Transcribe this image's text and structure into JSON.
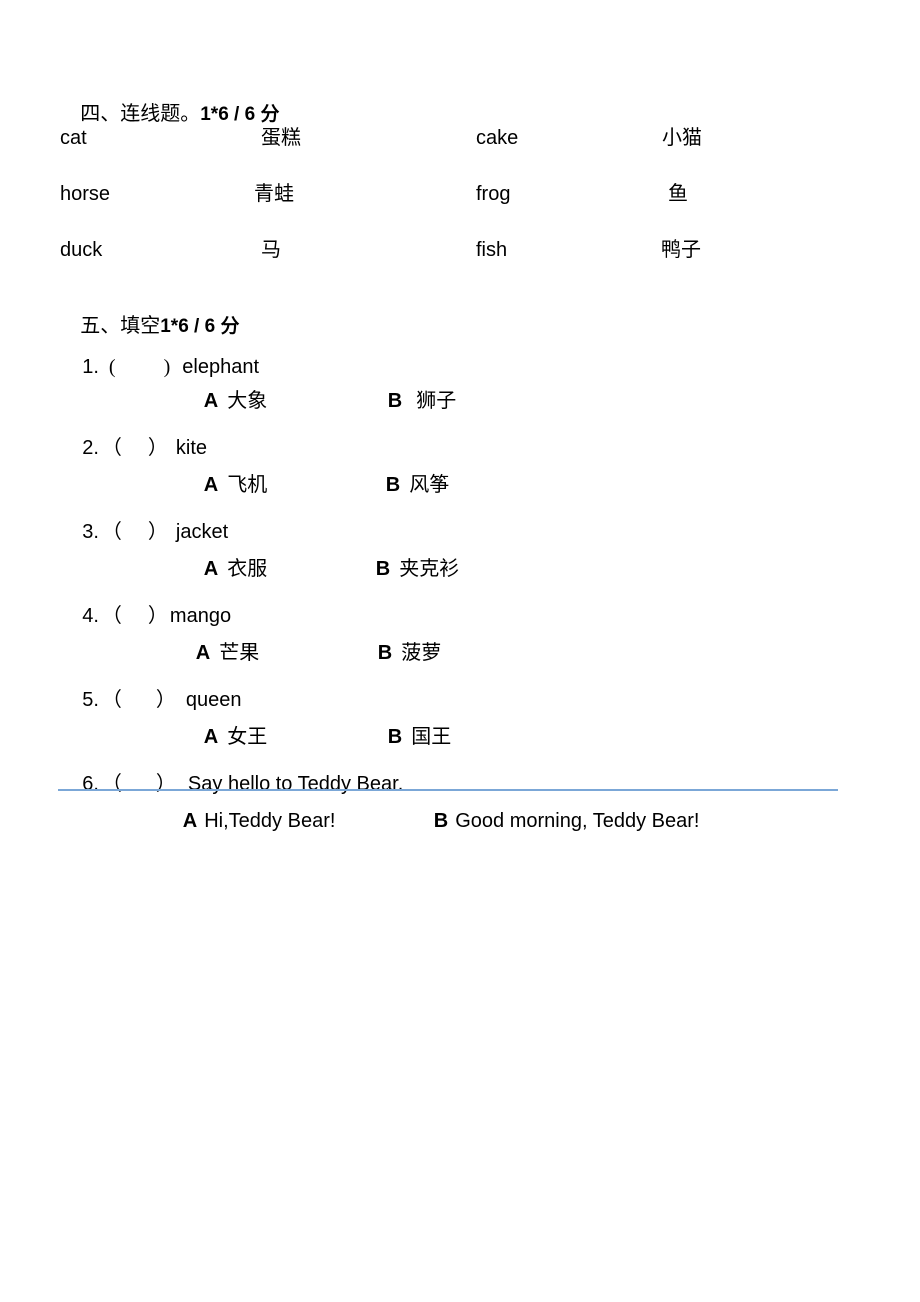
{
  "page": {
    "background_color": "#ffffff",
    "text_color": "#000000"
  },
  "sections": [
    {
      "id": "section-four",
      "heading": "四、连线题。1*6 / 6 分",
      "heading_label": "四、连线题。",
      "heading_score": "1*6 / 6 分",
      "type": "matching",
      "rows": [
        {
          "col1": "cat",
          "col2": "蛋糕",
          "col3": "cake",
          "col4": "小猫"
        },
        {
          "col1": "horse",
          "col2": "青蛙",
          "col3": "frog",
          "col4": "鱼"
        },
        {
          "col1": "duck",
          "col2": "马",
          "col3": "fish",
          "col4": "鸭子"
        }
      ]
    },
    {
      "id": "section-five",
      "heading": "五、填空 1*6 / 6 分",
      "heading_label": "五、填空",
      "heading_score": "1*6 / 6 分",
      "type": "multiple-choice",
      "questions": [
        {
          "number": "1.",
          "paren_open": "(",
          "paren_close": ")",
          "prompt": "elephant",
          "options": [
            {
              "letter": "A",
              "text": "大象",
              "lang": "cn"
            },
            {
              "letter": "B",
              "text": "狮子",
              "lang": "cn"
            }
          ]
        },
        {
          "number": "2.",
          "paren_open": "（",
          "paren_close": "）",
          "prompt": "kite",
          "options": [
            {
              "letter": "A",
              "text": "飞机",
              "lang": "cn"
            },
            {
              "letter": "B",
              "text": "风筝",
              "lang": "cn"
            }
          ]
        },
        {
          "number": "3.",
          "paren_open": "（",
          "paren_close": "）",
          "prompt": "jacket",
          "options": [
            {
              "letter": "A",
              "text": "衣服",
              "lang": "cn"
            },
            {
              "letter": "B",
              "text": "夹克衫",
              "lang": "cn"
            }
          ]
        },
        {
          "number": "4.",
          "paren_open": "（",
          "paren_close": "）",
          "prompt": "mango",
          "options": [
            {
              "letter": "A",
              "text": "芒果",
              "lang": "cn"
            },
            {
              "letter": "B",
              "text": "菠萝",
              "lang": "cn"
            }
          ]
        },
        {
          "number": "5.",
          "paren_open": "（",
          "paren_close": "）",
          "prompt": "queen",
          "options": [
            {
              "letter": "A",
              "text": "女王",
              "lang": "cn"
            },
            {
              "letter": "B",
              "text": "国王",
              "lang": "cn"
            }
          ]
        },
        {
          "number": "6.",
          "paren_open": "（",
          "paren_close": "）",
          "prompt": "Say hello to Teddy Bear.",
          "options": [
            {
              "letter": "A",
              "text": "Hi,Teddy Bear!",
              "lang": "en"
            },
            {
              "letter": "B",
              "text": "Good morning, Teddy Bear!",
              "lang": "en"
            }
          ]
        }
      ]
    }
  ],
  "divider": {
    "color": "#7ba7d7",
    "name": "horizontal-rule"
  }
}
